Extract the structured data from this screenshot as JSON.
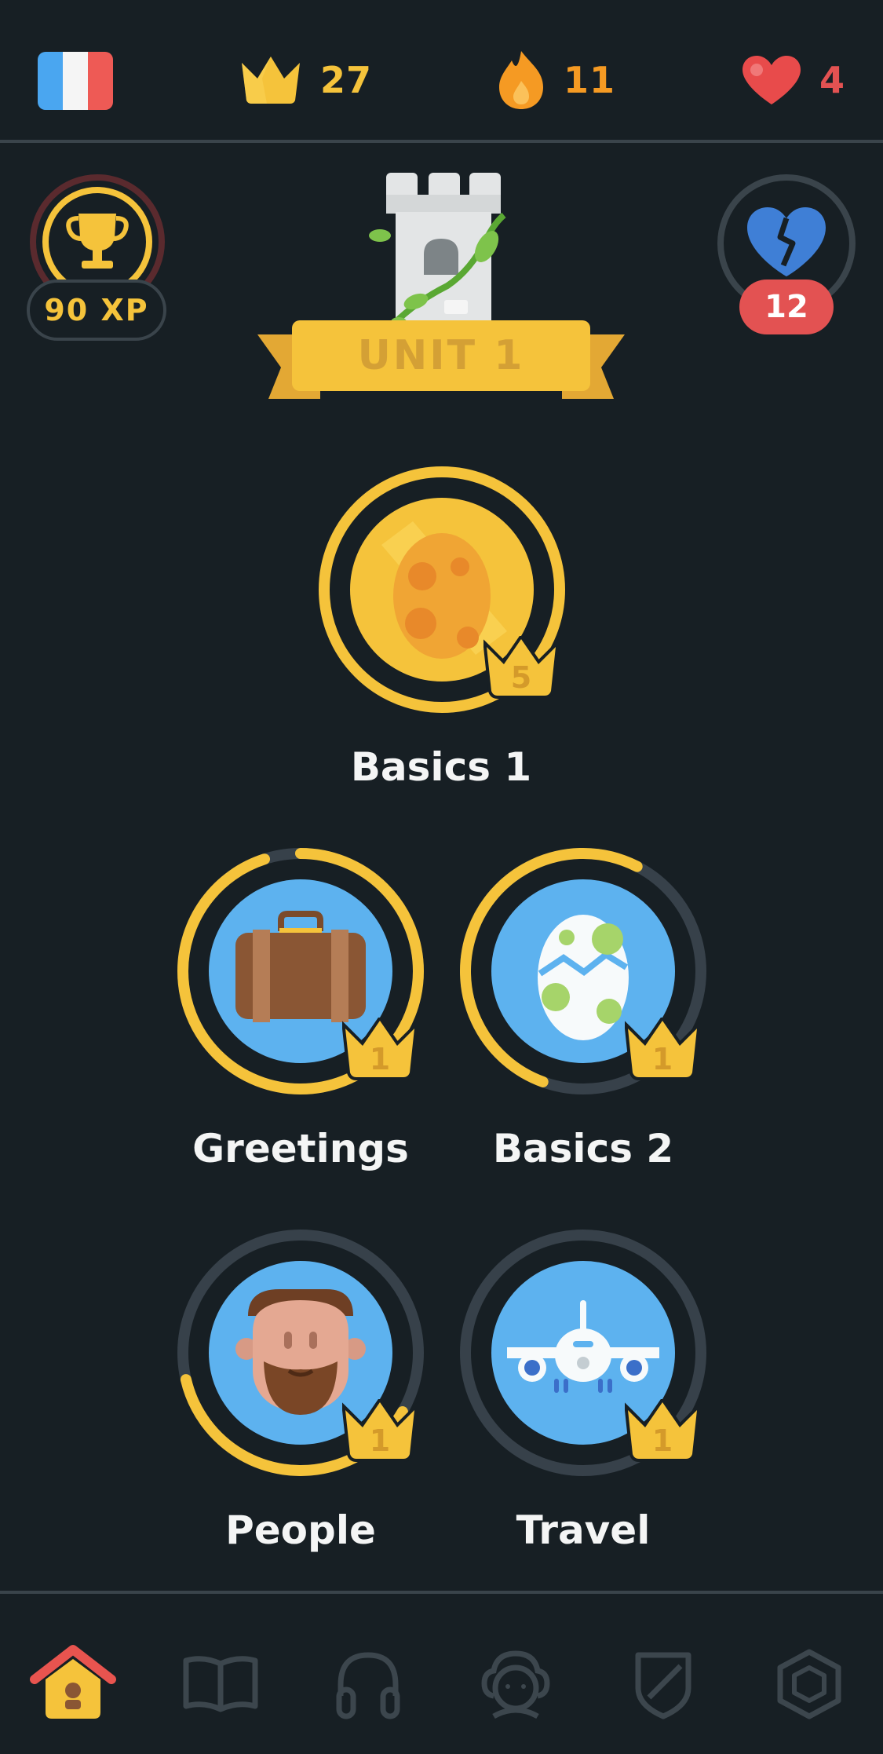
{
  "header": {
    "course_flag": "french-flag-icon",
    "crowns": "27",
    "streak": "11",
    "hearts": "4",
    "colors": {
      "crown": "#f5c33b",
      "streak": "#f59a23",
      "hearts": "#e35252"
    }
  },
  "unit": {
    "xp_label": "90 XP",
    "unit_label": "UNIT 1",
    "broken_heart_count": "12"
  },
  "skills": [
    {
      "name": "Basics 1",
      "crown_level": "5",
      "icon": "egg-icon",
      "progress": 1.0
    },
    {
      "name": "Greetings",
      "crown_level": "1",
      "icon": "suitcase-icon",
      "progress": 0.95
    },
    {
      "name": "Basics 2",
      "crown_level": "1",
      "icon": "spotted-egg-icon",
      "progress": 0.52
    },
    {
      "name": "People",
      "crown_level": "1",
      "icon": "bearded-man-icon",
      "progress": 0.38
    },
    {
      "name": "Travel",
      "crown_level": "1",
      "icon": "airplane-icon",
      "progress": 0.0
    }
  ],
  "nav": {
    "items": [
      {
        "icon": "home-icon",
        "active": true
      },
      {
        "icon": "stories-book-icon",
        "active": false
      },
      {
        "icon": "headphones-icon",
        "active": false
      },
      {
        "icon": "profile-avatar-icon",
        "active": false
      },
      {
        "icon": "league-shield-icon",
        "active": false
      },
      {
        "icon": "hexagon-shop-icon",
        "active": false
      }
    ]
  }
}
